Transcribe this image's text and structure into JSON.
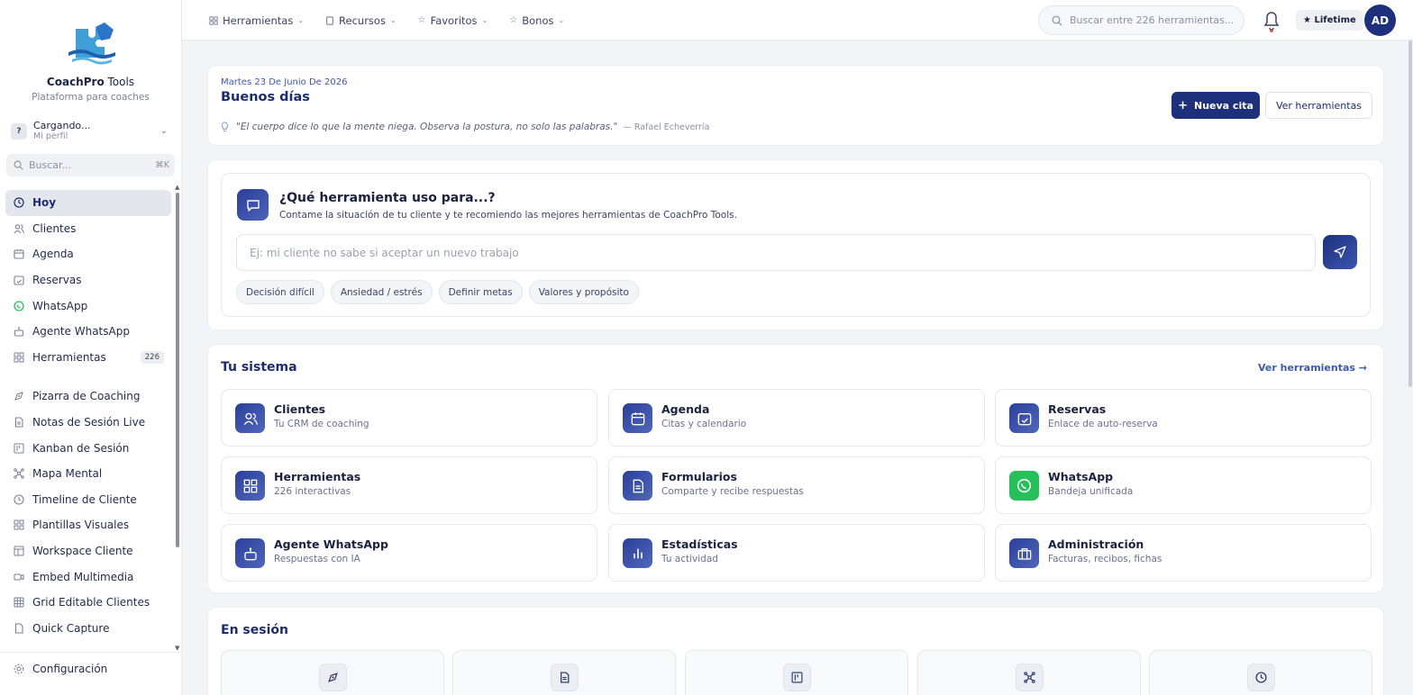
{
  "brand": {
    "name_bold": "CoachPro",
    "name_rest": " Tools",
    "subtitle": "Plataforma para coaches"
  },
  "profile": {
    "initial": "?",
    "name": "Cargando...",
    "sub": "Mi perfil"
  },
  "sidebar_search": {
    "placeholder": "Buscar...",
    "shortcut": "⌘K"
  },
  "sidebar": {
    "items": [
      {
        "label": "Hoy",
        "icon": "clock-icon",
        "active": true
      },
      {
        "label": "Clientes",
        "icon": "users-icon"
      },
      {
        "label": "Agenda",
        "icon": "calendar-icon"
      },
      {
        "label": "Reservas",
        "icon": "calendar-check-icon"
      },
      {
        "label": "WhatsApp",
        "icon": "whatsapp-icon"
      },
      {
        "label": "Agente WhatsApp",
        "icon": "bot-icon"
      },
      {
        "label": "Herramientas",
        "icon": "grid-icon",
        "count": "226"
      }
    ],
    "items2": [
      {
        "label": "Pizarra de Coaching",
        "icon": "pen-tool-icon"
      },
      {
        "label": "Notas de Sesión Live",
        "icon": "file-text-icon"
      },
      {
        "label": "Kanban de Sesión",
        "icon": "kanban-icon"
      },
      {
        "label": "Mapa Mental",
        "icon": "network-icon"
      },
      {
        "label": "Timeline de Cliente",
        "icon": "clock-icon"
      },
      {
        "label": "Plantillas Visuales",
        "icon": "grid-icon"
      },
      {
        "label": "Workspace Cliente",
        "icon": "layout-icon"
      },
      {
        "label": "Embed Multimedia",
        "icon": "video-icon"
      },
      {
        "label": "Grid Editable Clientes",
        "icon": "table-icon"
      },
      {
        "label": "Quick Capture",
        "icon": "file-icon"
      }
    ],
    "settings": "Configuración"
  },
  "topbar": {
    "menus": [
      {
        "label": "Herramientas",
        "icon": "grid-icon"
      },
      {
        "label": "Recursos",
        "icon": "book-icon"
      },
      {
        "label": "Favoritos",
        "icon": "star-icon"
      },
      {
        "label": "Bonos",
        "icon": "star-icon"
      }
    ],
    "search_placeholder": "Buscar entre 226 herramientas...",
    "plan": "★ Lifetime",
    "avatar": "AD"
  },
  "greeting": {
    "date": "Martes 23 De Junio De 2026",
    "hello": "Buenos días",
    "quote": "\"El cuerpo dice lo que la mente niega. Observa la postura, no solo las palabras.\"",
    "author": "— Rafael Echeverría",
    "primary_button": "Nueva cita",
    "secondary_button": "Ver herramientas"
  },
  "ask": {
    "title": "¿Qué herramienta uso para...?",
    "subtitle": "Contame la situación de tu cliente y te recomiendo las mejores herramientas de CoachPro Tools.",
    "placeholder": "Ej: mi cliente no sabe si aceptar un nuevo trabajo",
    "chips": [
      "Decisión difícil",
      "Ansiedad / estrés",
      "Definir metas",
      "Valores y propósito"
    ]
  },
  "system": {
    "title": "Tu sistema",
    "link": "Ver herramientas →",
    "tiles": [
      {
        "title": "Clientes",
        "sub": "Tu CRM de coaching",
        "icon": "users-icon"
      },
      {
        "title": "Agenda",
        "sub": "Citas y calendario",
        "icon": "calendar-icon"
      },
      {
        "title": "Reservas",
        "sub": "Enlace de auto-reserva",
        "icon": "calendar-check-icon"
      },
      {
        "title": "Herramientas",
        "sub": "226 interactivas",
        "icon": "grid-icon"
      },
      {
        "title": "Formularios",
        "sub": "Comparte y recibe respuestas",
        "icon": "file-text-icon"
      },
      {
        "title": "WhatsApp",
        "sub": "Bandeja unificada",
        "icon": "whatsapp-icon",
        "color": "#26c05a"
      },
      {
        "title": "Agente WhatsApp",
        "sub": "Respuestas con IA",
        "icon": "bot-icon"
      },
      {
        "title": "Estadísticas",
        "sub": "Tu actividad",
        "icon": "bar-chart-icon"
      },
      {
        "title": "Administración",
        "sub": "Facturas, recibos, fichas",
        "icon": "briefcase-icon"
      }
    ]
  },
  "session": {
    "title": "En sesión",
    "tiles": [
      {
        "icon": "pen-tool-icon"
      },
      {
        "icon": "file-text-icon"
      },
      {
        "icon": "kanban-icon"
      },
      {
        "icon": "network-icon"
      },
      {
        "icon": "clock-icon"
      }
    ]
  },
  "colors": {
    "accent": "#1e2f7c",
    "whatsapp": "#26c05a",
    "text": "#1a2240"
  }
}
